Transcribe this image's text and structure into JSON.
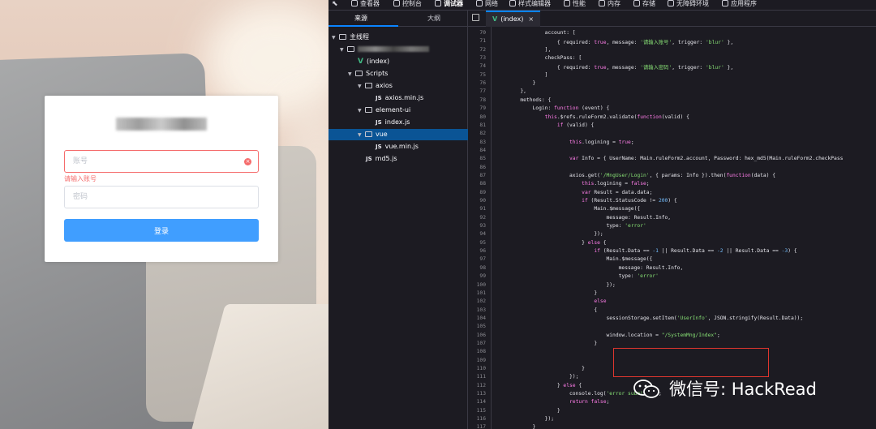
{
  "login": {
    "account_placeholder": "账号",
    "account_error": "请输入账号",
    "password_placeholder": "密码",
    "login_button": "登录",
    "clear_icon": "circle-close-icon",
    "error_color": "#f56c6c",
    "primary_color": "#409eff"
  },
  "devtools": {
    "toolbar": {
      "items": [
        {
          "label": "查看器",
          "icon": "inspector-icon"
        },
        {
          "label": "控制台",
          "icon": "console-icon"
        },
        {
          "label": "调试器",
          "icon": "debugger-icon",
          "active": true
        },
        {
          "label": "网络",
          "icon": "network-icon"
        },
        {
          "label": "样式编辑器",
          "icon": "style-editor-icon"
        },
        {
          "label": "性能",
          "icon": "performance-icon"
        },
        {
          "label": "内存",
          "icon": "memory-icon"
        },
        {
          "label": "存储",
          "icon": "storage-icon"
        },
        {
          "label": "无障碍环境",
          "icon": "accessibility-icon"
        },
        {
          "label": "应用程序",
          "icon": "application-icon"
        }
      ]
    },
    "sidebar": {
      "tabs": [
        "来源",
        "大纲"
      ],
      "tree": [
        {
          "label": "主线程",
          "kind": "thread"
        },
        {
          "label": "",
          "kind": "host"
        },
        {
          "label": "(index)",
          "kind": "vue"
        },
        {
          "label": "Scripts",
          "kind": "folder"
        },
        {
          "label": "axios",
          "kind": "folder"
        },
        {
          "label": "axios.min.js",
          "kind": "js"
        },
        {
          "label": "element-ui",
          "kind": "folder"
        },
        {
          "label": "index.js",
          "kind": "js"
        },
        {
          "label": "vue",
          "kind": "folder",
          "selected": true
        },
        {
          "label": "vue.min.js",
          "kind": "js"
        },
        {
          "label": "md5.js",
          "kind": "js"
        }
      ]
    },
    "editor": {
      "tab_label": "(index)",
      "tab_close": "×",
      "accent": "#0a84ff",
      "highlight_color": "#e0362e",
      "lines": [
        {
          "n": "70",
          "t": "                account: ["
        },
        {
          "n": "71",
          "t": "                    { required: true, message: '请输入账号', trigger: 'blur' },"
        },
        {
          "n": "72",
          "t": "                ],"
        },
        {
          "n": "73",
          "t": "                checkPass: ["
        },
        {
          "n": "74",
          "t": "                    { required: true, message: '请输入密码', trigger: 'blur' },"
        },
        {
          "n": "75",
          "t": "                ]"
        },
        {
          "n": "76",
          "t": "            }"
        },
        {
          "n": "77",
          "t": "        },"
        },
        {
          "n": "78",
          "t": "        methods: {"
        },
        {
          "n": "79",
          "t": "            Login: function (event) {"
        },
        {
          "n": "80",
          "t": "                this.$refs.ruleForm2.validate(function(valid) {"
        },
        {
          "n": "81",
          "t": "                    if (valid) {"
        },
        {
          "n": "82",
          "t": ""
        },
        {
          "n": "83",
          "t": "                        this.logining = true;"
        },
        {
          "n": "84",
          "t": ""
        },
        {
          "n": "85",
          "t": "                        var Info = { UserName: Main.ruleForm2.account, Password: hex_md5(Main.ruleForm2.checkPass"
        },
        {
          "n": "86",
          "t": ""
        },
        {
          "n": "87",
          "t": "                        axios.get('/MngUser/Login', { params: Info }).then(function(data) {"
        },
        {
          "n": "88",
          "t": "                            this.logining = false;"
        },
        {
          "n": "89",
          "t": "                            var Result = data.data;"
        },
        {
          "n": "90",
          "t": "                            if (Result.StatusCode != 200) {"
        },
        {
          "n": "91",
          "t": "                                Main.$message({"
        },
        {
          "n": "92",
          "t": "                                    message: Result.Info,"
        },
        {
          "n": "93",
          "t": "                                    type: 'error'"
        },
        {
          "n": "94",
          "t": "                                });"
        },
        {
          "n": "95",
          "t": "                            } else {"
        },
        {
          "n": "96",
          "t": "                                if (Result.Data == -1 || Result.Data == -2 || Result.Data == -3) {"
        },
        {
          "n": "97",
          "t": "                                    Main.$message({"
        },
        {
          "n": "98",
          "t": "                                        message: Result.Info,"
        },
        {
          "n": "99",
          "t": "                                        type: 'error'"
        },
        {
          "n": "100",
          "t": "                                    });"
        },
        {
          "n": "101",
          "t": "                                }"
        },
        {
          "n": "102",
          "t": "                                else"
        },
        {
          "n": "103",
          "t": "                                {"
        },
        {
          "n": "104",
          "t": "                                    sessionStorage.setItem('UserInfo', JSON.stringify(Result.Data));"
        },
        {
          "n": "105",
          "t": ""
        },
        {
          "n": "106",
          "t": "                                    window.location = \"/SystemMng/Index\";"
        },
        {
          "n": "107",
          "t": "                                }"
        },
        {
          "n": "108",
          "t": ""
        },
        {
          "n": "109",
          "t": ""
        },
        {
          "n": "110",
          "t": "                            }"
        },
        {
          "n": "111",
          "t": "                        });"
        },
        {
          "n": "112",
          "t": "                    } else {"
        },
        {
          "n": "113",
          "t": "                        console.log('error submit!!');"
        },
        {
          "n": "114",
          "t": "                        return false;"
        },
        {
          "n": "115",
          "t": "                    }"
        },
        {
          "n": "116",
          "t": "                });"
        },
        {
          "n": "117",
          "t": "            }"
        }
      ]
    }
  },
  "watermark": {
    "text": "微信号: HackRead",
    "icon": "wechat-icon"
  }
}
